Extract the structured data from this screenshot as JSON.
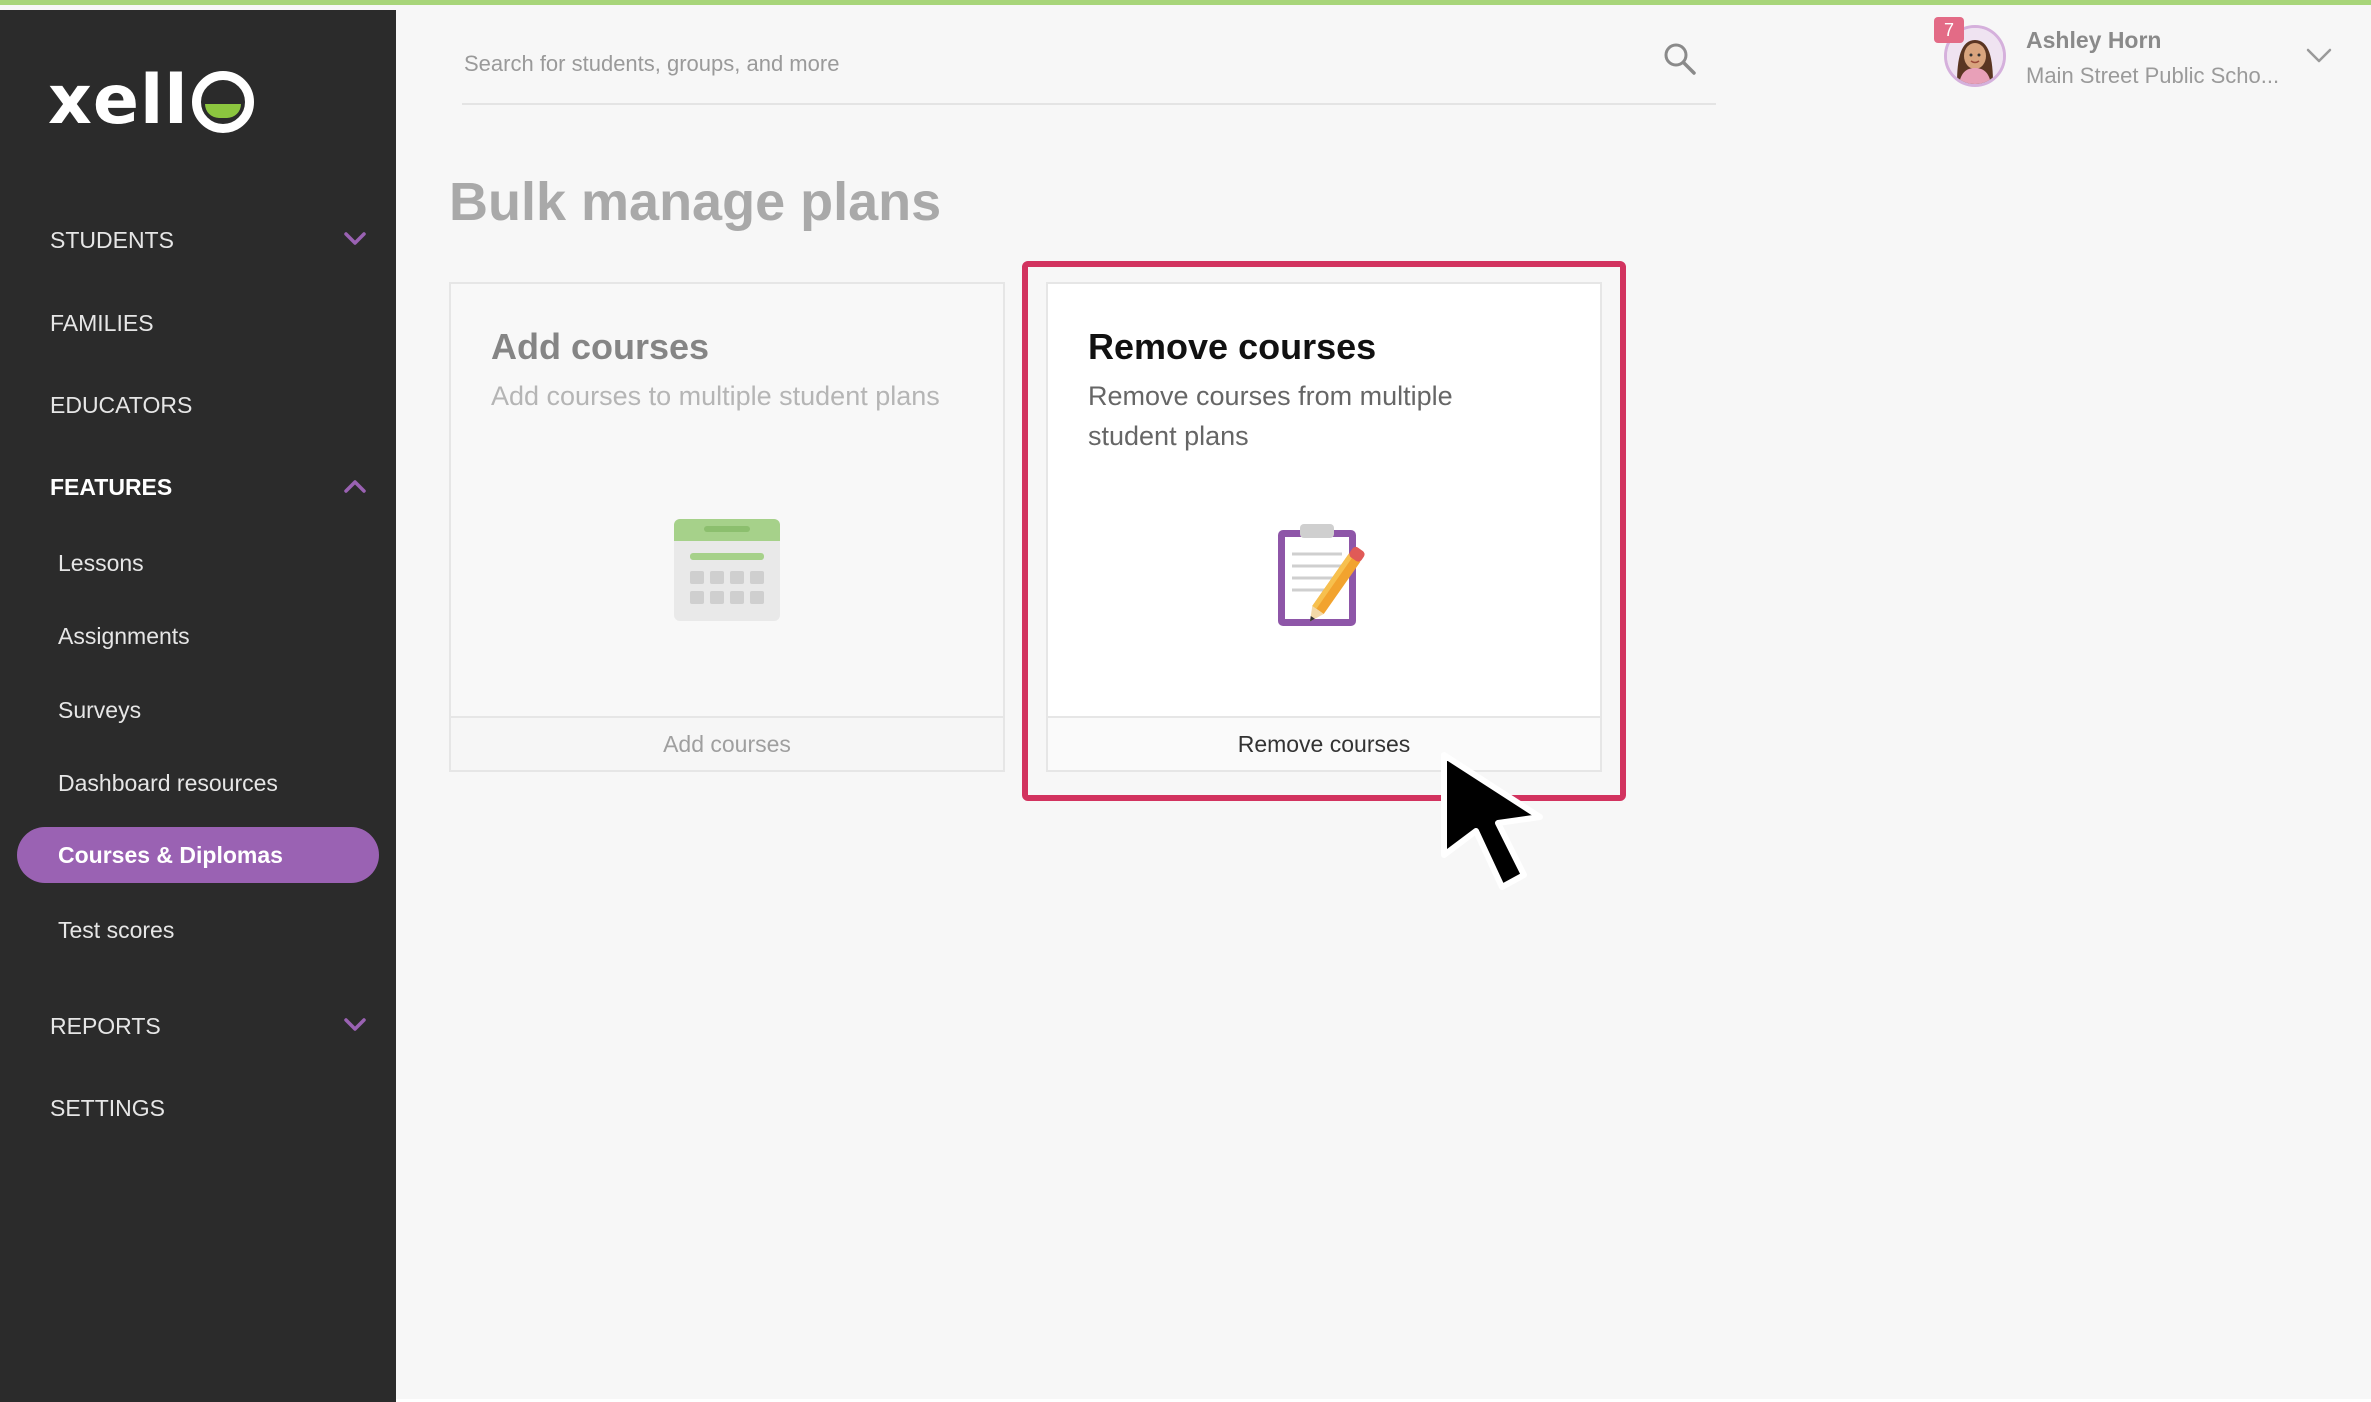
{
  "brand": {
    "logo_text": "xell",
    "accent": "#9a62b3",
    "highlight": "#d2335f"
  },
  "sidebar": {
    "items": [
      {
        "label": "STUDENTS",
        "expandable": true,
        "expanded": false
      },
      {
        "label": "FAMILIES"
      },
      {
        "label": "EDUCATORS"
      },
      {
        "label": "FEATURES",
        "expandable": true,
        "expanded": true,
        "bold": true
      },
      {
        "label": "Lessons"
      },
      {
        "label": "Assignments"
      },
      {
        "label": "Surveys"
      },
      {
        "label": "Dashboard resources"
      },
      {
        "label": "Courses & Diplomas",
        "active": true
      },
      {
        "label": "Test scores"
      },
      {
        "label": "REPORTS",
        "expandable": true,
        "expanded": false
      },
      {
        "label": "SETTINGS"
      }
    ]
  },
  "search": {
    "placeholder": "Search for students, groups, and more",
    "icon": "search-icon"
  },
  "profile": {
    "name": "Ashley Horn",
    "school": "Main Street Public Scho...",
    "notifications": "7"
  },
  "page": {
    "title": "Bulk manage plans"
  },
  "cards": [
    {
      "title": "Add courses",
      "description": "Add courses to multiple student plans",
      "footer": "Add courses",
      "icon": "calendar-icon",
      "state": "disabled"
    },
    {
      "title": "Remove courses",
      "description": "Remove courses from multiple student plans",
      "footer": "Remove courses",
      "icon": "clipboard-pencil-icon",
      "state": "highlighted"
    }
  ]
}
